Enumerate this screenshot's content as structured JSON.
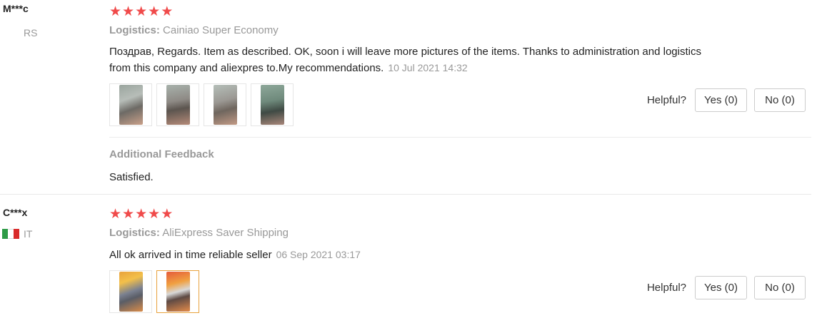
{
  "reviews": [
    {
      "user": "M***c",
      "country": "RS",
      "rating": 5,
      "logistics_label": "Logistics:",
      "logistics": "Cainiao Super Economy",
      "text": "Поздрав, Regards. Item as described. OK, soon i will leave more pictures of the items. Thanks to administration and logistics from this company and aliexpres to.My recommendations.",
      "date": "10 Jul 2021 14:32",
      "photo_count": 4,
      "helpful_label": "Helpful?",
      "yes_label": "Yes (0)",
      "no_label": "No (0)",
      "additional_feedback_title": "Additional Feedback",
      "additional_feedback_text": "Satisfied."
    },
    {
      "user": "C***x",
      "country": "IT",
      "flag_colors": [
        "#2e9b47",
        "#ffffff",
        "#d92b2b"
      ],
      "rating": 5,
      "logistics_label": "Logistics:",
      "logistics": "AliExpress Saver Shipping",
      "text": "All ok arrived in time reliable seller",
      "date": "06 Sep 2021 03:17",
      "photo_count": 2,
      "selected_photo": 2,
      "helpful_label": "Helpful?",
      "yes_label": "Yes (0)",
      "no_label": "No (0)"
    }
  ],
  "star_color": "#f04a4a",
  "selected_photo_border_color": "#e8a23d"
}
